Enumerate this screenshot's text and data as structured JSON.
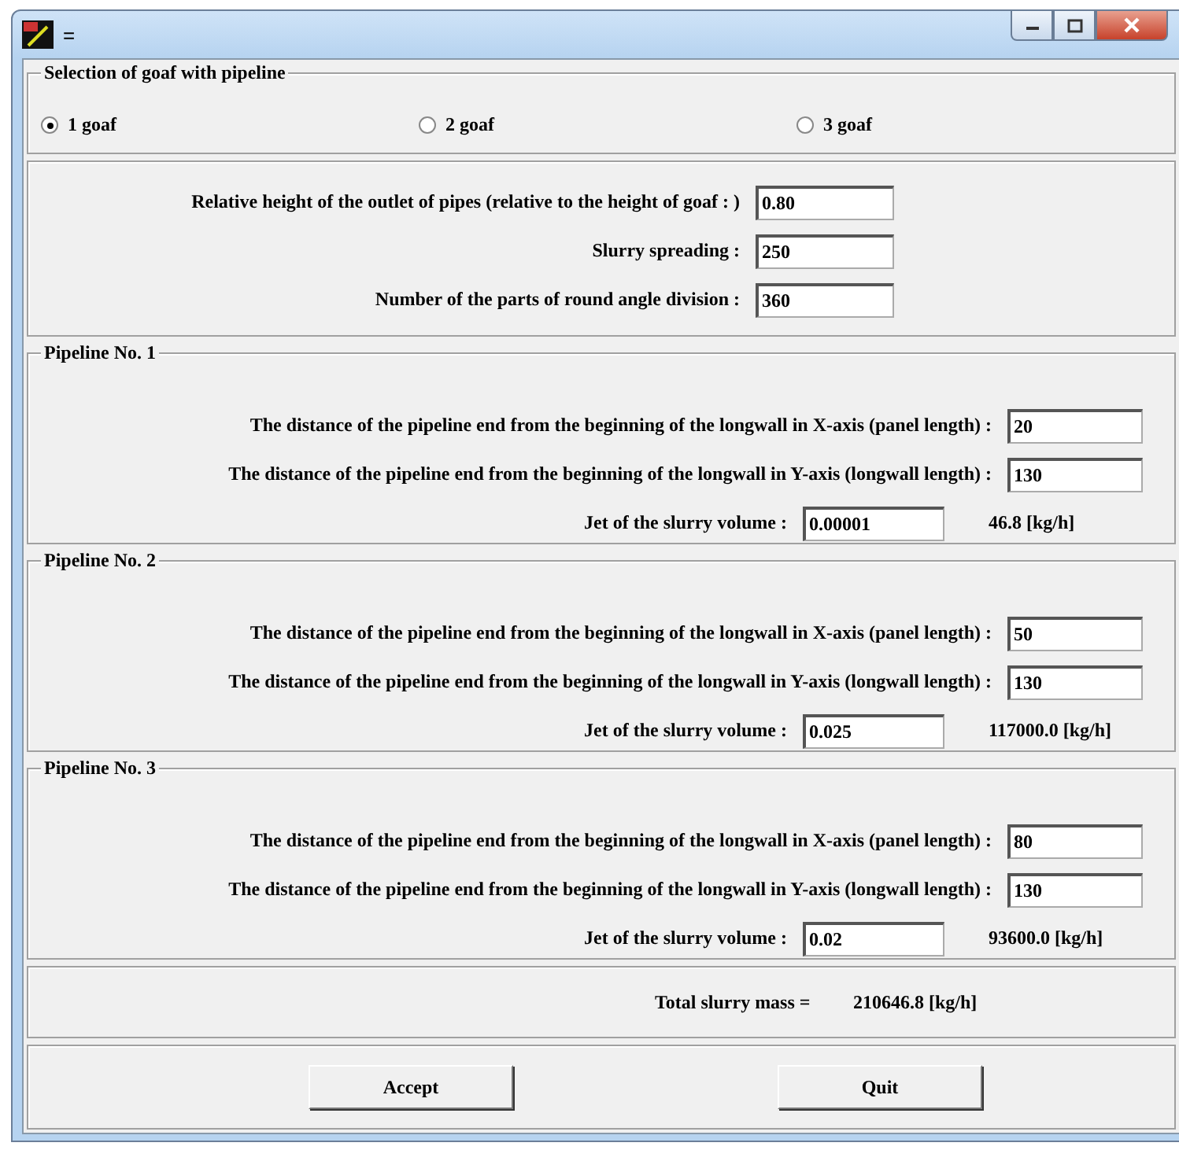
{
  "window": {
    "title": "="
  },
  "selection": {
    "title": "Selection of goaf with pipeline",
    "options": [
      {
        "label": "1 goaf",
        "selected": true
      },
      {
        "label": "2 goaf",
        "selected": false
      },
      {
        "label": "3 goaf",
        "selected": false
      }
    ]
  },
  "parameters": [
    {
      "label": "Relative height of the outlet of pipes (relative to the height of goaf : )",
      "value": "0.80"
    },
    {
      "label": "Slurry spreading :",
      "value": "250"
    },
    {
      "label": "Number of the parts of round angle division :",
      "value": "360"
    }
  ],
  "pipelines": [
    {
      "title": "Pipeline No. 1",
      "x_label": "The distance of the pipeline end from the beginning of the longwall in X-axis (panel length) :",
      "x_value": "20",
      "y_label": "The distance of the pipeline end from the beginning of the longwall in Y-axis (longwall length) :",
      "y_value": "130",
      "jet_label": "Jet of the slurry volume :",
      "jet_value": "0.00001",
      "result": "46.8  [kg/h]"
    },
    {
      "title": "Pipeline No. 2",
      "x_label": "The distance of the pipeline end from the beginning of the longwall in X-axis (panel length) :",
      "x_value": "50",
      "y_label": "The distance of the pipeline end from the beginning of the longwall in Y-axis (longwall length) :",
      "y_value": "130",
      "jet_label": "Jet of the slurry volume :",
      "jet_value": "0.025",
      "result": "117000.0  [kg/h]"
    },
    {
      "title": "Pipeline No. 3",
      "x_label": "The distance of the pipeline end from the beginning of the longwall in X-axis (panel length) :",
      "x_value": "80",
      "y_label": "The distance of the pipeline end from the beginning of the longwall in Y-axis (longwall length) :",
      "y_value": "130",
      "jet_label": "Jet of the slurry volume :",
      "jet_value": "0.02",
      "result": "93600.0  [kg/h]"
    }
  ],
  "total": {
    "label": "Total slurry mass =",
    "value": "210646.8  [kg/h]"
  },
  "buttons": [
    "Accept",
    "Quit"
  ]
}
